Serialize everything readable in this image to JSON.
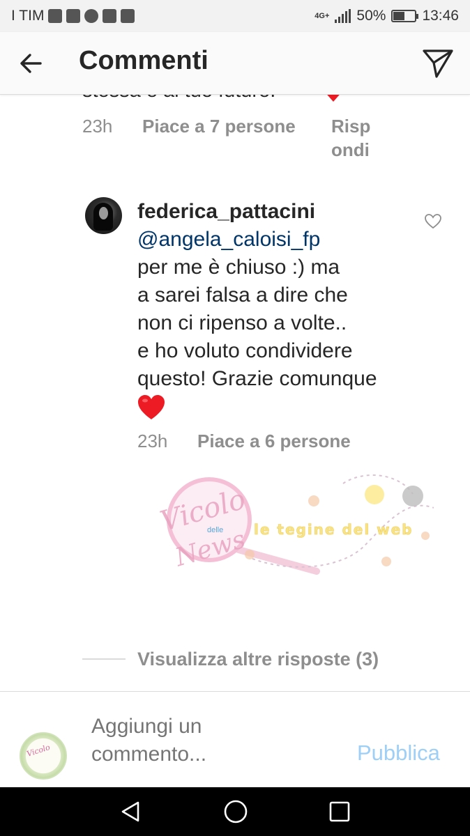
{
  "status_bar": {
    "carrier": "I TIM",
    "network": "4G+",
    "battery": "50%",
    "battery_level": 0.5,
    "time": "13:46"
  },
  "header": {
    "title": "Commenti"
  },
  "previous_comment": {
    "text": "stessa e al tuo futuro.",
    "time": "23h",
    "likes": "Piace a 7 persone",
    "reply": "Rispondi"
  },
  "comment": {
    "username": "federica_pattacini",
    "mention": "@angela_caloisi_fp",
    "lines": [
      "per me è chiuso :) ma",
      "a sarei falsa a dire che",
      "non ci ripenso a volte..",
      "e ho voluto condividere",
      "questo! Grazie comunque"
    ],
    "time": "23h",
    "likes": "Piace a 6 persone"
  },
  "watermark": {
    "brand_line1": "Vicolo",
    "brand_small": "delle",
    "brand_line2": "News",
    "tagline": "le tegine del web"
  },
  "replies": {
    "more_label": "Visualizza altre risposte (3)"
  },
  "composer": {
    "placeholder": "Aggiungi un commento...",
    "publish_label": "Pubblica",
    "avatar_text": "Vicolo"
  },
  "colors": {
    "mention": "#003569",
    "publish": "#9dcff7",
    "heart": "#ed1c24",
    "secondary_text": "#8e8e8e"
  }
}
